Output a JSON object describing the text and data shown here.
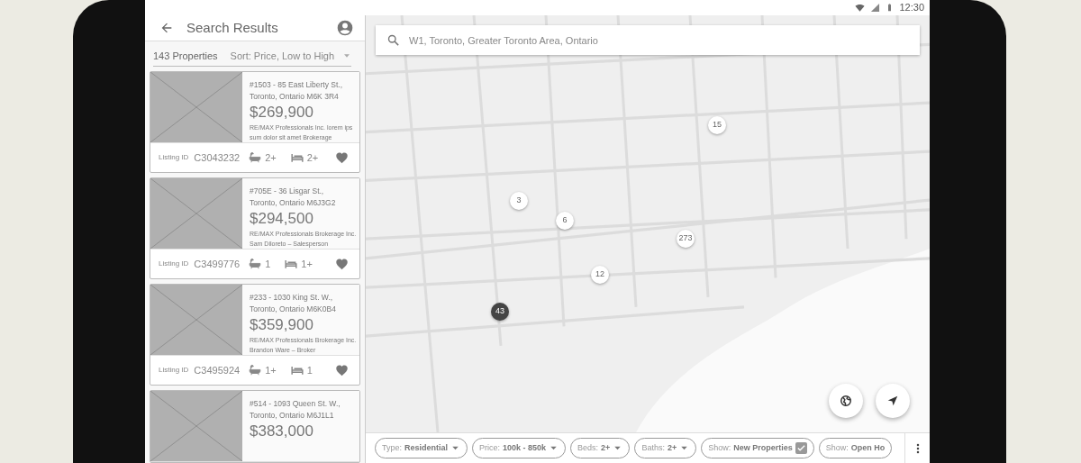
{
  "status_bar": {
    "time": "12:30"
  },
  "header": {
    "title": "Search Results"
  },
  "list_summary": {
    "count": "143 Properties",
    "sort": "Sort: Price, Low to High"
  },
  "listings": [
    {
      "address_line1": "#1503 - 85 East Liberty St.,",
      "address_line2": "Toronto, Ontario  M6K 3R4",
      "price": "$269,900",
      "brokerage_line1": "RE/MAX Professionals Inc. lorem ips",
      "brokerage_line2": "sum dolor sit amet Brokerage",
      "listing_id_label": "Listing ID",
      "listing_id": "C3043232",
      "baths": "2+",
      "beds": "2+"
    },
    {
      "address_line1": "#705E - 36 Lisgar St.,",
      "address_line2": "Toronto, Ontario  M6J3G2",
      "price": "$294,500",
      "brokerage_line1": "RE/MAX Professionals Brokerage Inc.",
      "brokerage_line2": "Sam Diloreto – Salesperson",
      "listing_id_label": "Listing ID",
      "listing_id": "C3499776",
      "baths": "1",
      "beds": "1+"
    },
    {
      "address_line1": "#233 - 1030 King St. W.,",
      "address_line2": "Toronto, Ontario  M6K0B4",
      "price": "$359,900",
      "brokerage_line1": "RE/MAX Professionals Brokerage Inc.",
      "brokerage_line2": "Brandon Ware – Broker",
      "listing_id_label": "Listing ID",
      "listing_id": "C3495924",
      "baths": "1+",
      "beds": "1"
    },
    {
      "address_line1": "#514 - 1093 Queen St. W.,",
      "address_line2": "Toronto, Ontario  M6J1L1",
      "price": "$383,000"
    }
  ],
  "map": {
    "search": {
      "placeholder": "W1, Toronto, Greater Toronto Area, Ontario"
    },
    "clusters": [
      {
        "count": "15",
        "selected": false
      },
      {
        "count": "3",
        "selected": false
      },
      {
        "count": "6",
        "selected": false
      },
      {
        "count": "273",
        "selected": false
      },
      {
        "count": "12",
        "selected": false
      },
      {
        "count": "43",
        "selected": true
      }
    ]
  },
  "filters": [
    {
      "kind": "dropdown",
      "label": "Type:",
      "value": "Residential"
    },
    {
      "kind": "dropdown",
      "label": "Price:",
      "value": "100k - 850k"
    },
    {
      "kind": "dropdown",
      "label": "Beds:",
      "value": "2+"
    },
    {
      "kind": "dropdown",
      "label": "Baths:",
      "value": "2+"
    },
    {
      "kind": "checkbox",
      "label": "Show:",
      "value": "New Properties",
      "checked": true
    },
    {
      "kind": "plain",
      "label": "Show:",
      "value": "Open Ho"
    }
  ]
}
